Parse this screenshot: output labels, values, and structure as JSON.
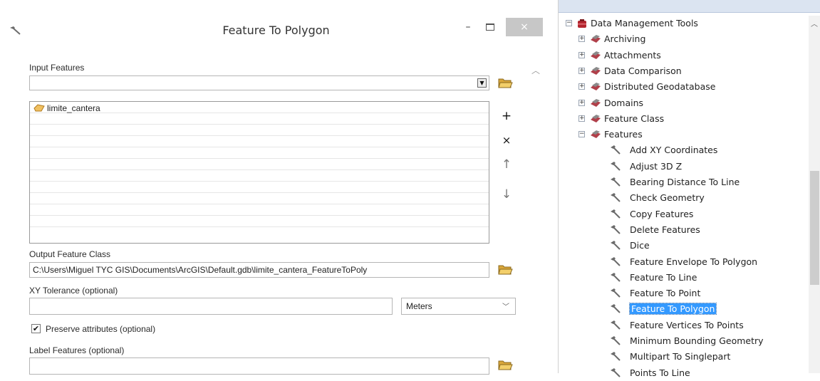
{
  "dialog": {
    "title": "Feature To Polygon",
    "minimize": "–",
    "close": "×",
    "input_features": {
      "label": "Input Features",
      "value": "",
      "items": [
        "limite_cantera"
      ]
    },
    "output_feature_class": {
      "label": "Output Feature Class",
      "value": "C:\\Users\\Miguel TYC GIS\\Documents\\ArcGIS\\Default.gdb\\limite_cantera_FeatureToPoly"
    },
    "xy_tolerance": {
      "label": "XY Tolerance (optional)",
      "value": "",
      "units": "Meters"
    },
    "preserve_attributes": {
      "label": "Preserve attributes (optional)",
      "checked": true
    },
    "label_features": {
      "label": "Label Features (optional)",
      "value": ""
    },
    "side_buttons": {
      "add": "+",
      "remove": "×",
      "up": "↑",
      "down": "↓"
    }
  },
  "toolbox": {
    "header": "",
    "root": "Data Management Tools",
    "toolsets": [
      "Archiving",
      "Attachments",
      "Data Comparison",
      "Distributed Geodatabase",
      "Domains",
      "Feature Class",
      "Features"
    ],
    "tools": [
      "Add XY Coordinates",
      "Adjust 3D Z",
      "Bearing Distance To Line",
      "Check Geometry",
      "Copy Features",
      "Delete Features",
      "Dice",
      "Feature Envelope To Polygon",
      "Feature To Line",
      "Feature To Point",
      "Feature To Polygon",
      "Feature Vertices To Points",
      "Minimum Bounding Geometry",
      "Multipart To Singlepart",
      "Points To Line"
    ],
    "selected_tool": "Feature To Polygon"
  },
  "colors": {
    "selection": "#3399ff",
    "toolbox_header": "#dbe4f1",
    "toolset_icon": "#b0404a",
    "folder": "#e8b84a"
  },
  "icons": {
    "title": "hammer-icon",
    "folder": "open-folder-icon",
    "layer": "polygon-layer-icon",
    "toolbox": "toolbox-icon",
    "toolset": "toolset-icon",
    "tool": "hammer-icon"
  }
}
